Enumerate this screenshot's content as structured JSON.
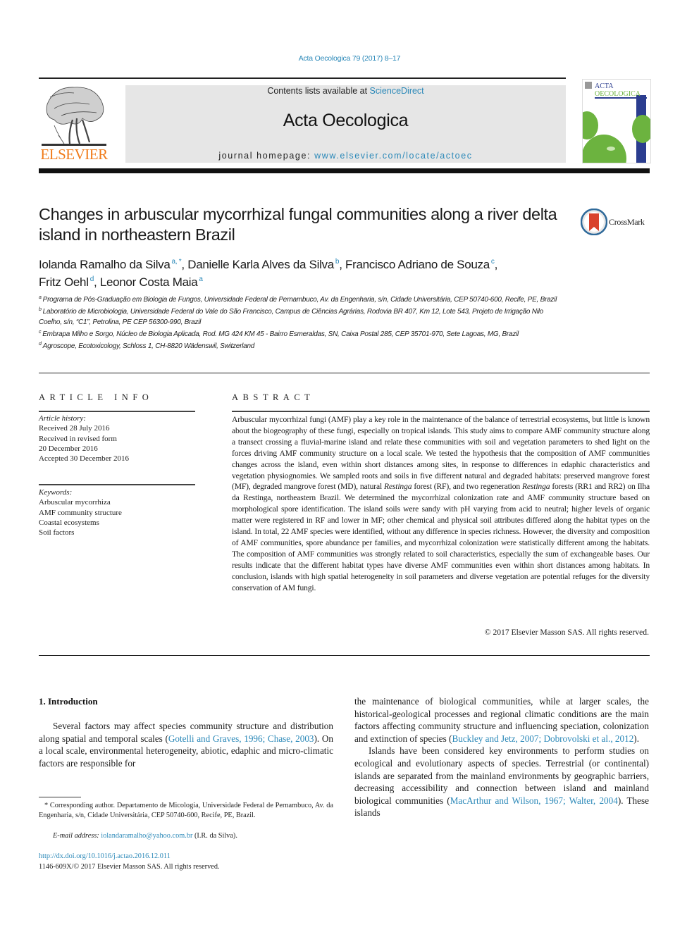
{
  "header": {
    "citation": "Acta Oecologica 79 (2017) 8–17",
    "contents_prefix": "Contents lists available at ",
    "contents_link": "ScienceDirect",
    "journal_title": "Acta Oecologica",
    "homepage_prefix": "journal homepage: ",
    "homepage_link": "www.elsevier.com/locate/actoec",
    "publisher_logo": "ELSEVIER",
    "cover": {
      "line1": "ACTA",
      "line2": "OECOLOGICA",
      "accent_green": "#6cb33f",
      "accent_blue": "#2b3d8f"
    }
  },
  "article": {
    "title": "Changes in arbuscular mycorrhizal fungal communities along a river delta island in northeastern Brazil",
    "crossmark_label": "CrossMark",
    "authors": [
      {
        "name": "Iolanda Ramalho da Silva",
        "sup": "a, *",
        "sep": ", "
      },
      {
        "name": "Danielle Karla Alves da Silva",
        "sup": "b",
        "sep": ", "
      },
      {
        "name": "Francisco Adriano de Souza",
        "sup": "c",
        "sep": ","
      },
      {
        "name": "Fritz Oehl",
        "sup": "d",
        "sep": ", "
      },
      {
        "name": "Leonor Costa Maia",
        "sup": "a",
        "sep": ""
      }
    ],
    "affiliations": [
      {
        "key": "a",
        "text": "Programa de Pós-Graduação em Biologia de Fungos, Universidade Federal de Pernambuco, Av. da Engenharia, s/n, Cidade Universitária, CEP 50740-600, Recife, PE, Brazil"
      },
      {
        "key": "b",
        "text": "Laboratório de Microbiologia, Universidade Federal do Vale do São Francisco, Campus de Ciências Agrárias, Rodovia BR 407, Km 12, Lote 543, Projeto de Irrigação Nilo Coelho, s/n, “C1”, Petrolina, PE CEP 56300-990, Brazil"
      },
      {
        "key": "c",
        "text": "Embrapa Milho e Sorgo, Núcleo de Biologia Aplicada, Rod. MG 424 KM 45 - Bairro Esmeraldas, SN, Caixa Postal 285, CEP 35701-970, Sete Lagoas, MG, Brazil"
      },
      {
        "key": "d",
        "text": "Agroscope, Ecotoxicology, Schloss 1, CH-8820 Wädenswil, Switzerland"
      }
    ]
  },
  "article_info": {
    "heading": "ARTICLE INFO",
    "history_label": "Article history:",
    "history": [
      "Received 28 July 2016",
      "Received in revised form",
      "20 December 2016",
      "Accepted 30 December 2016"
    ],
    "keywords_label": "Keywords:",
    "keywords": [
      "Arbuscular mycorrhiza",
      "AMF community structure",
      "Coastal ecosystems",
      "Soil factors"
    ]
  },
  "abstract": {
    "heading": "ABSTRACT",
    "part1": "Arbuscular mycorrhizal fungi (AMF) play a key role in the maintenance of the balance of terrestrial ecosystems, but little is known about the biogeography of these fungi, especially on tropical islands. This study aims to compare AMF community structure along a transect crossing a fluvial-marine island and relate these communities with soil and vegetation parameters to shed light on the forces driving AMF community structure on a local scale. We tested the hypothesis that the composition of AMF communities changes across the island, even within short distances among sites, in response to differences in edaphic characteristics and vegetation physiognomies. We sampled roots and soils in five different natural and degraded habitats: preserved mangrove forest (MF), degraded mangrove forest (MD), natural ",
    "italic1": "Restinga",
    "part2": " forest (RF), and two regeneration ",
    "italic2": "Restinga",
    "part3": " forests (RR1 and RR2) on Ilha da Restinga, northeastern Brazil. We determined the mycorrhizal colonization rate and AMF community structure based on morphological spore identification. The island soils were sandy with pH varying from acid to neutral; higher levels of organic matter were registered in RF and lower in MF; other chemical and physical soil attributes differed along the habitat types on the island. In total, 22 AMF species were identified, without any difference in species richness. However, the diversity and composition of AMF communities, spore abundance per families, and mycorrhizal colonization were statistically different among the habitats. The composition of AMF communities was strongly related to soil characteristics, especially the sum of exchangeable bases. Our results indicate that the different habitat types have diverse AMF communities even within short distances among habitats. In conclusion, islands with high spatial heterogeneity in soil parameters and diverse vegetation are potential refuges for the diversity conservation of AM fungi.",
    "copyright": "© 2017 Elsevier Masson SAS. All rights reserved."
  },
  "introduction": {
    "heading": "1.  Introduction",
    "left_p1_a": "Several factors may affect species community structure and distribution along spatial and temporal scales (",
    "left_p1_ref": "Gotelli and Graves, 1996; Chase, 2003",
    "left_p1_b": "). On a local scale, environmental heterogeneity, abiotic, edaphic and micro-climatic factors are responsible for",
    "right_p1_a": "the maintenance of biological communities, while at larger scales, the historical-geological processes and regional climatic conditions are the main factors affecting community structure and influencing speciation, colonization and extinction of species (",
    "right_p1_ref": "Buckley and Jetz, 2007; Dobrovolski et al., 2012",
    "right_p1_b": ").",
    "right_p2_a": "Islands have been considered key environments to perform studies on ecological and evolutionary aspects of species. Terrestrial (or continental) islands are separated from the mainland environments by geographic barriers, decreasing accessibility and connection between island and mainland biological communities (",
    "right_p2_ref": "MacArthur and Wilson, 1967; Walter, 2004",
    "right_p2_b": "). These islands"
  },
  "footnotes": {
    "corresponding": "* Corresponding author. Departamento de Micologia, Universidade Federal de Pernambuco, Av. da Engenharia, s/n, Cidade Universitária, CEP 50740-600, Recife, PE, Brazil.",
    "email_label": "E-mail address: ",
    "email": "iolandaramalho@yahoo.com.br",
    "email_suffix": " (I.R. da Silva).",
    "doi": "http://dx.doi.org/10.1016/j.actao.2016.12.011",
    "issn": "1146-609X/© 2017 Elsevier Masson SAS. All rights reserved."
  }
}
